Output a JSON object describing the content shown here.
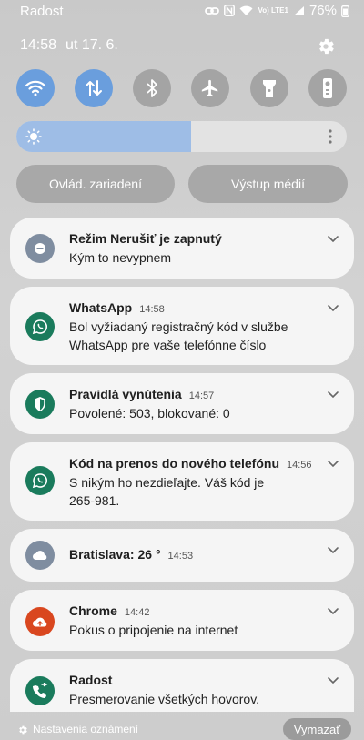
{
  "status_bar": {
    "carrier": "Radost",
    "network_label": "Vo) LTE1",
    "battery_percent": "76%"
  },
  "header": {
    "time": "14:58",
    "date": "ut 17. 6."
  },
  "quick_settings": [
    {
      "name": "wifi",
      "on": true
    },
    {
      "name": "mobile-data",
      "on": true
    },
    {
      "name": "bluetooth",
      "on": false
    },
    {
      "name": "airplane-mode",
      "on": false
    },
    {
      "name": "flashlight",
      "on": false
    },
    {
      "name": "remote-control",
      "on": false
    }
  ],
  "brightness": {
    "level_percent": 53
  },
  "shortcuts": {
    "device_control": "Ovlád. zariadení",
    "media_output": "Výstup médií"
  },
  "notifications": [
    {
      "title": "Režim Nerušiť je zapnutý",
      "time": "",
      "body": [
        "Kým to nevypnem"
      ],
      "icon": "minus-circle-icon",
      "icon_color": "#7f8da0"
    },
    {
      "title": "WhatsApp",
      "time": "14:58",
      "body": [
        "Bol vyžiadaný registračný kód v službe",
        "WhatsApp pre vaše telefónne číslo"
      ],
      "icon": "whatsapp-icon",
      "icon_color": "#1a7b5c"
    },
    {
      "title": "Pravidlá vynútenia",
      "time": "14:57",
      "body": [
        "Povolené: 503, blokované: 0"
      ],
      "icon": "shield-icon",
      "icon_color": "#1a7b5c"
    },
    {
      "title": "Kód na prenos do nového telefónu",
      "time": "14:56",
      "body": [
        "S nikým ho nezdieľajte. Váš kód je",
        "265-981."
      ],
      "icon": "whatsapp-icon",
      "icon_color": "#1a7b5c"
    },
    {
      "title": "Bratislava: 26 °",
      "time": "14:53",
      "body": [],
      "icon": "cloud-icon",
      "icon_color": "#7f8da0"
    },
    {
      "title": "Chrome",
      "time": "14:42",
      "body": [
        "Pokus o pripojenie na internet"
      ],
      "icon": "cloud-upload-icon",
      "icon_color": "#d9471f"
    },
    {
      "title": "Radost",
      "time": "",
      "body": [
        "Presmerovanie všetkých hovorov."
      ],
      "icon": "call-forward-icon",
      "icon_color": "#1a7b5c"
    }
  ],
  "footer": {
    "settings_label": "Nastavenia oznámení",
    "clear_label": "Vymazať"
  }
}
